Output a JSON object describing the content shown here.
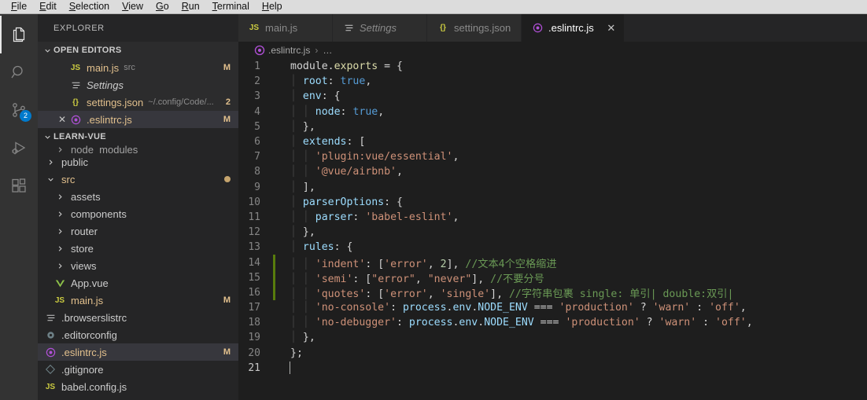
{
  "menubar": {
    "items": [
      {
        "mn": "F",
        "rest": "ile"
      },
      {
        "mn": "E",
        "rest": "dit"
      },
      {
        "mn": "S",
        "rest": "election"
      },
      {
        "mn": "V",
        "rest": "iew"
      },
      {
        "mn": "G",
        "rest": "o"
      },
      {
        "mn": "R",
        "rest": "un"
      },
      {
        "mn": "T",
        "rest": "erminal"
      },
      {
        "mn": "H",
        "rest": "elp"
      }
    ]
  },
  "activitybar": {
    "items": [
      {
        "name": "explorer",
        "icon": "files-icon",
        "active": true,
        "badge": ""
      },
      {
        "name": "search",
        "icon": "search-icon",
        "active": false,
        "badge": ""
      },
      {
        "name": "source-control",
        "icon": "source-control-icon",
        "active": false,
        "badge": "2"
      },
      {
        "name": "run-debug",
        "icon": "run-debug-icon",
        "active": false,
        "badge": ""
      },
      {
        "name": "extensions",
        "icon": "extensions-icon",
        "active": false,
        "badge": ""
      }
    ]
  },
  "sidebar": {
    "title": "EXPLORER",
    "open_editors": {
      "header": "OPEN EDITORS",
      "items": [
        {
          "icon": "JS",
          "icon_class": "c-js",
          "label": "main.js",
          "desc": "src",
          "mark": "M",
          "label_class": "c-mod"
        },
        {
          "icon": "settings-editor-icon",
          "icon_class": "c-white",
          "label": "Settings",
          "desc": "",
          "mark": "",
          "label_class": "c-white italic"
        },
        {
          "icon": "{}",
          "icon_class": "c-json",
          "label": "settings.json",
          "desc": "~/.config/Code/...",
          "mark": "2",
          "label_class": "c-mod"
        },
        {
          "icon": "eslint-icon",
          "icon_class": "c-eslint",
          "label": ".eslintrc.js",
          "desc": "",
          "mark": "M",
          "label_class": "c-mod"
        }
      ]
    },
    "project": {
      "header": "LEARN-VUE",
      "clipped_item": "node_modules",
      "items": [
        {
          "indent": 1,
          "twisty": "chevron-right",
          "icon": "",
          "label": "public",
          "mark": "",
          "label_class": "c-white"
        },
        {
          "indent": 1,
          "twisty": "chevron-down",
          "icon": "",
          "label": "src",
          "mark": "dot",
          "label_class": "c-mod"
        },
        {
          "indent": 2,
          "twisty": "chevron-right",
          "icon": "",
          "label": "assets",
          "mark": "",
          "label_class": "c-white"
        },
        {
          "indent": 2,
          "twisty": "chevron-right",
          "icon": "",
          "label": "components",
          "mark": "",
          "label_class": "c-white"
        },
        {
          "indent": 2,
          "twisty": "chevron-right",
          "icon": "",
          "label": "router",
          "mark": "",
          "label_class": "c-white"
        },
        {
          "indent": 2,
          "twisty": "chevron-right",
          "icon": "",
          "label": "store",
          "mark": "",
          "label_class": "c-white"
        },
        {
          "indent": 2,
          "twisty": "chevron-right",
          "icon": "",
          "label": "views",
          "mark": "",
          "label_class": "c-white"
        },
        {
          "indent": 2,
          "twisty": "",
          "icon": "vue-icon",
          "label": "App.vue",
          "mark": "",
          "label_class": "c-white"
        },
        {
          "indent": 2,
          "twisty": "",
          "icon": "JS",
          "label": "main.js",
          "mark": "M",
          "label_class": "c-mod"
        },
        {
          "indent": 1,
          "twisty": "",
          "icon": "config-icon",
          "label": ".browserslistrc",
          "mark": "",
          "label_class": "c-white"
        },
        {
          "indent": 1,
          "twisty": "",
          "icon": "gear-icon",
          "label": ".editorconfig",
          "mark": "",
          "label_class": "c-white"
        },
        {
          "indent": 1,
          "twisty": "",
          "icon": "eslint-icon",
          "label": ".eslintrc.js",
          "mark": "M",
          "label_class": "c-mod",
          "selected": true
        },
        {
          "indent": 1,
          "twisty": "",
          "icon": "git-icon",
          "label": ".gitignore",
          "mark": "",
          "label_class": "c-white"
        },
        {
          "indent": 1,
          "twisty": "",
          "icon": "JS",
          "label": "babel.config.js",
          "mark": "",
          "label_class": "c-white"
        }
      ]
    }
  },
  "tabs": [
    {
      "icon": "JS",
      "icon_class": "c-js",
      "label": "main.js",
      "active": false,
      "italic": false,
      "closable": false
    },
    {
      "icon": "settings-editor-icon",
      "icon_class": "c-white",
      "label": "Settings",
      "active": false,
      "italic": true,
      "closable": false
    },
    {
      "icon": "{}",
      "icon_class": "c-json",
      "label": "settings.json",
      "active": false,
      "italic": false,
      "closable": false
    },
    {
      "icon": "eslint-icon",
      "icon_class": "c-eslint",
      "label": ".eslintrc.js",
      "active": true,
      "italic": false,
      "closable": true
    }
  ],
  "breadcrumbs": {
    "icon": "eslint-icon",
    "file": ".eslintrc.js",
    "sep": "›",
    "more": "…"
  },
  "editor": {
    "language": "javascript",
    "cursor_line": 21,
    "total_lines": 21,
    "git_added_lines": [
      14,
      15,
      16
    ],
    "lines": [
      {
        "n": 1,
        "tokens": [
          {
            "t": "plain",
            "v": "module"
          },
          {
            "t": "op",
            "v": "."
          },
          {
            "t": "fn",
            "v": "exports"
          },
          {
            "t": "op",
            "v": " = {"
          }
        ]
      },
      {
        "n": 2,
        "tokens": [
          {
            "t": "guide",
            "v": "  "
          },
          {
            "t": "prop",
            "v": "root"
          },
          {
            "t": "op",
            "v": ": "
          },
          {
            "t": "bool",
            "v": "true"
          },
          {
            "t": "op",
            "v": ","
          }
        ]
      },
      {
        "n": 3,
        "tokens": [
          {
            "t": "guide",
            "v": "  "
          },
          {
            "t": "prop",
            "v": "env"
          },
          {
            "t": "op",
            "v": ": {"
          }
        ]
      },
      {
        "n": 4,
        "tokens": [
          {
            "t": "guide",
            "v": "    "
          },
          {
            "t": "prop",
            "v": "node"
          },
          {
            "t": "op",
            "v": ": "
          },
          {
            "t": "bool",
            "v": "true"
          },
          {
            "t": "op",
            "v": ","
          }
        ]
      },
      {
        "n": 5,
        "tokens": [
          {
            "t": "guide",
            "v": "  "
          },
          {
            "t": "op",
            "v": "},"
          }
        ]
      },
      {
        "n": 6,
        "tokens": [
          {
            "t": "guide",
            "v": "  "
          },
          {
            "t": "prop",
            "v": "extends"
          },
          {
            "t": "op",
            "v": ": ["
          }
        ]
      },
      {
        "n": 7,
        "tokens": [
          {
            "t": "guide",
            "v": "    "
          },
          {
            "t": "str",
            "v": "'plugin:vue/essential'"
          },
          {
            "t": "op",
            "v": ","
          }
        ]
      },
      {
        "n": 8,
        "tokens": [
          {
            "t": "guide",
            "v": "    "
          },
          {
            "t": "str",
            "v": "'@vue/airbnb'"
          },
          {
            "t": "op",
            "v": ","
          }
        ]
      },
      {
        "n": 9,
        "tokens": [
          {
            "t": "guide",
            "v": "  "
          },
          {
            "t": "op",
            "v": "],"
          }
        ]
      },
      {
        "n": 10,
        "tokens": [
          {
            "t": "guide",
            "v": "  "
          },
          {
            "t": "prop",
            "v": "parserOptions"
          },
          {
            "t": "op",
            "v": ": {"
          }
        ]
      },
      {
        "n": 11,
        "tokens": [
          {
            "t": "guide",
            "v": "    "
          },
          {
            "t": "prop",
            "v": "parser"
          },
          {
            "t": "op",
            "v": ": "
          },
          {
            "t": "str",
            "v": "'babel-eslint'"
          },
          {
            "t": "op",
            "v": ","
          }
        ]
      },
      {
        "n": 12,
        "tokens": [
          {
            "t": "guide",
            "v": "  "
          },
          {
            "t": "op",
            "v": "},"
          }
        ]
      },
      {
        "n": 13,
        "tokens": [
          {
            "t": "guide",
            "v": "  "
          },
          {
            "t": "prop",
            "v": "rules"
          },
          {
            "t": "op",
            "v": ": {"
          }
        ]
      },
      {
        "n": 14,
        "tokens": [
          {
            "t": "guide",
            "v": "    "
          },
          {
            "t": "str",
            "v": "'indent'"
          },
          {
            "t": "op",
            "v": ": ["
          },
          {
            "t": "str",
            "v": "'error'"
          },
          {
            "t": "op",
            "v": ", "
          },
          {
            "t": "num",
            "v": "2"
          },
          {
            "t": "op",
            "v": "], "
          },
          {
            "t": "cmt",
            "v": "//文本4个空格缩进"
          }
        ]
      },
      {
        "n": 15,
        "tokens": [
          {
            "t": "guide",
            "v": "    "
          },
          {
            "t": "str",
            "v": "'semi'"
          },
          {
            "t": "op",
            "v": ": ["
          },
          {
            "t": "str",
            "v": "\"error\""
          },
          {
            "t": "op",
            "v": ", "
          },
          {
            "t": "str",
            "v": "\"never\""
          },
          {
            "t": "op",
            "v": "], "
          },
          {
            "t": "cmt",
            "v": "//不要分号"
          }
        ]
      },
      {
        "n": 16,
        "tokens": [
          {
            "t": "guide",
            "v": "    "
          },
          {
            "t": "str",
            "v": "'quotes'"
          },
          {
            "t": "op",
            "v": ": ["
          },
          {
            "t": "str",
            "v": "'error'"
          },
          {
            "t": "op",
            "v": ", "
          },
          {
            "t": "str",
            "v": "'single'"
          },
          {
            "t": "op",
            "v": "], "
          },
          {
            "t": "cmt",
            "v": "//字符串包裹 single: 单引| double:双引|"
          }
        ]
      },
      {
        "n": 17,
        "tokens": [
          {
            "t": "guide",
            "v": "    "
          },
          {
            "t": "str",
            "v": "'no-console'"
          },
          {
            "t": "op",
            "v": ": "
          },
          {
            "t": "prop",
            "v": "process"
          },
          {
            "t": "op",
            "v": "."
          },
          {
            "t": "prop",
            "v": "env"
          },
          {
            "t": "op",
            "v": "."
          },
          {
            "t": "prop",
            "v": "NODE_ENV"
          },
          {
            "t": "op",
            "v": " === "
          },
          {
            "t": "str",
            "v": "'production'"
          },
          {
            "t": "op",
            "v": " ? "
          },
          {
            "t": "str",
            "v": "'warn'"
          },
          {
            "t": "op",
            "v": " : "
          },
          {
            "t": "str",
            "v": "'off'"
          },
          {
            "t": "op",
            "v": ","
          }
        ]
      },
      {
        "n": 18,
        "tokens": [
          {
            "t": "guide",
            "v": "    "
          },
          {
            "t": "str",
            "v": "'no-debugger'"
          },
          {
            "t": "op",
            "v": ": "
          },
          {
            "t": "prop",
            "v": "process"
          },
          {
            "t": "op",
            "v": "."
          },
          {
            "t": "prop",
            "v": "env"
          },
          {
            "t": "op",
            "v": "."
          },
          {
            "t": "prop",
            "v": "NODE_ENV"
          },
          {
            "t": "op",
            "v": " === "
          },
          {
            "t": "str",
            "v": "'production'"
          },
          {
            "t": "op",
            "v": " ? "
          },
          {
            "t": "str",
            "v": "'warn'"
          },
          {
            "t": "op",
            "v": " : "
          },
          {
            "t": "str",
            "v": "'off'"
          },
          {
            "t": "op",
            "v": ","
          }
        ]
      },
      {
        "n": 19,
        "tokens": [
          {
            "t": "guide",
            "v": "  "
          },
          {
            "t": "op",
            "v": "},"
          }
        ]
      },
      {
        "n": 20,
        "tokens": [
          {
            "t": "op",
            "v": "};"
          }
        ]
      },
      {
        "n": 21,
        "tokens": []
      }
    ]
  },
  "colors": {
    "accent": "#007acc",
    "background": "#1e1e1e",
    "sidebar": "#252526",
    "activitybar": "#333333",
    "modified": "#e2c08d",
    "git_added": "#587c0c",
    "eslint": "#b150d8"
  }
}
